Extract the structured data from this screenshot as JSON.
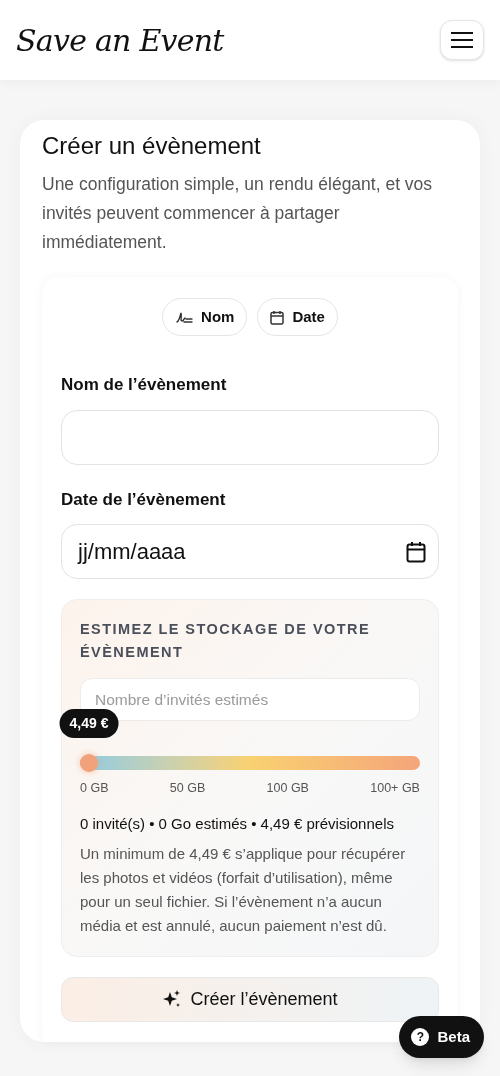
{
  "header": {
    "logo": "Save an Event"
  },
  "page": {
    "title": "Créer un évènement",
    "intro": "Une configuration simple, un rendu élégant, et vos invités peuvent commencer à partager immédiatement."
  },
  "steps": [
    {
      "kind": "signature",
      "label": "Nom"
    },
    {
      "kind": "calendar",
      "label": "Date"
    }
  ],
  "fields": [
    {
      "kind": "text",
      "label": "Nom de l’évènement"
    },
    {
      "kind": "date",
      "label": "Date de l’évènement",
      "value": "jj/mm/aaaa"
    }
  ],
  "storage": {
    "heading": "ESTIMEZ LE STOCKAGE DE VOTRE ÉVÈNEMENT",
    "guests_placeholder": "Nombre d’invités estimés",
    "price_badge": "4,49 €",
    "level": 0,
    "ticks": [
      "0 GB",
      "50 GB",
      "100 GB",
      "100+ GB"
    ],
    "summary": "0 invité(s) • 0 Go estimés • 4,49 € prévisionnels",
    "note": "Un minimum de 4,49 € s’applique pour récupérer les photos et vidéos (forfait d’utilisation), même pour un seul fichier. Si l’évènement n’a aucun média et est annulé, aucun paiement n’est dû."
  },
  "submit": "Créer l’évènement",
  "beta": {
    "icon": "?",
    "label": "Beta"
  }
}
